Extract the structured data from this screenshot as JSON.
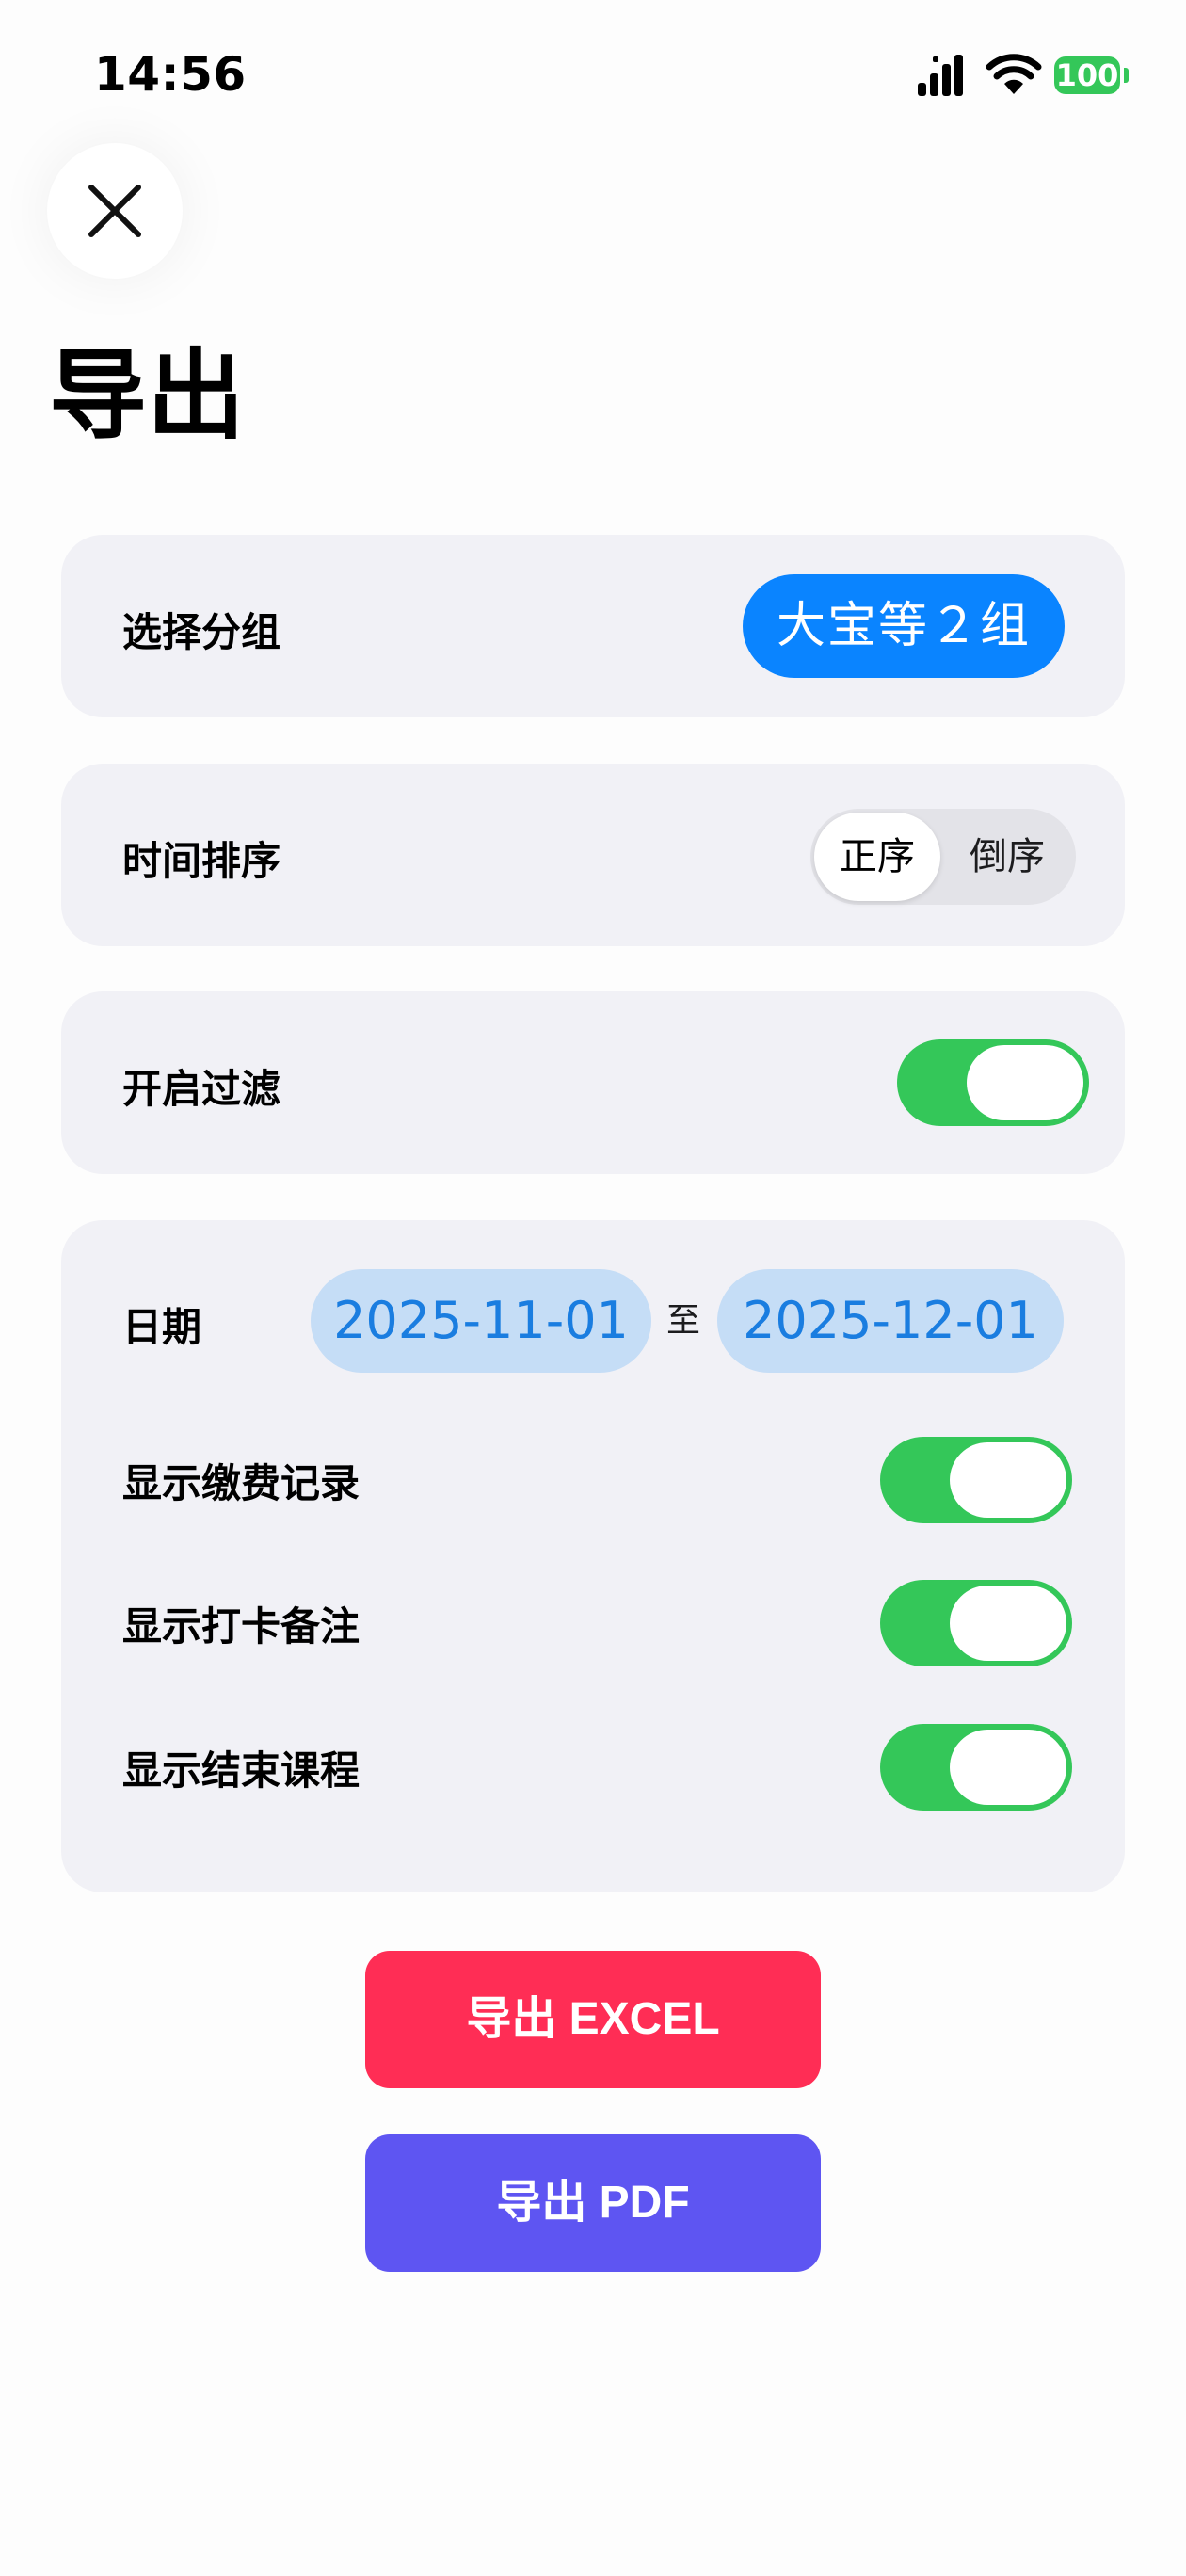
{
  "status_bar": {
    "time": "14:56",
    "battery": "100",
    "signal_icon": "signal-bars-icon",
    "wifi_icon": "wifi-icon"
  },
  "header": {
    "close_icon": "close-icon",
    "title": "导出"
  },
  "group": {
    "label": "选择分组",
    "value": "大宝等２组"
  },
  "sort": {
    "label": "时间排序",
    "options": [
      "正序",
      "倒序"
    ],
    "selected": "正序"
  },
  "filter": {
    "label": "开启过滤",
    "enabled": true
  },
  "filter_options": {
    "date_label": "日期",
    "date_from": "2025-11-01",
    "date_separator": "至",
    "date_to": "2025-12-01",
    "toggles": [
      {
        "label": "显示缴费记录",
        "on": true
      },
      {
        "label": "显示打卡备注",
        "on": true
      },
      {
        "label": "显示结束课程",
        "on": true
      }
    ]
  },
  "actions": {
    "excel_label": "导出 EXCEL",
    "pdf_label": "导出 PDF"
  },
  "colors": {
    "accent_blue": "#0a84ff",
    "toggle_green": "#34c759",
    "excel_red": "#ff2d55",
    "pdf_purple": "#5e55f2",
    "card_bg": "#f1f1f6"
  }
}
